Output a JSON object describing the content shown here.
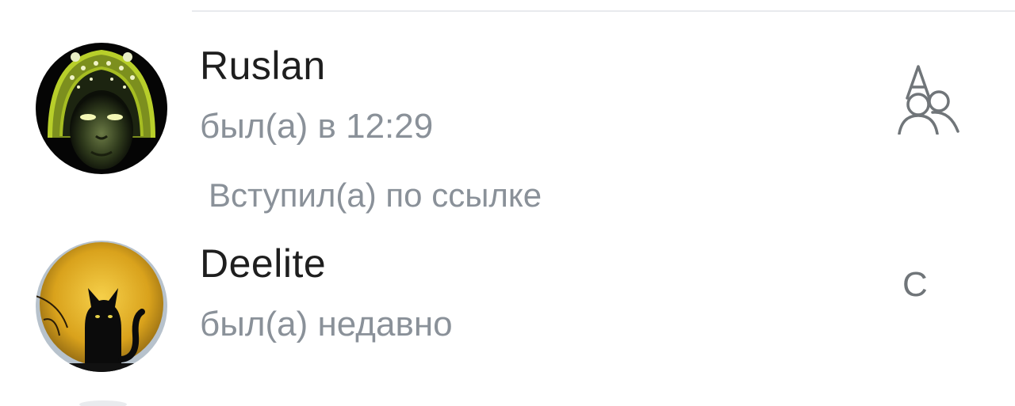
{
  "members": [
    {
      "name": "Ruslan",
      "status": "был(а) в 12:29",
      "joined_note": "Вступил(а) по ссылке",
      "role_icon": "group-icon"
    },
    {
      "name": "Deelite",
      "status": "был(а) недавно",
      "role_letter": "С"
    }
  ],
  "colors": {
    "name_text": "#1e1e1e",
    "secondary_text": "#8a9199",
    "icon_gray": "#707579"
  }
}
